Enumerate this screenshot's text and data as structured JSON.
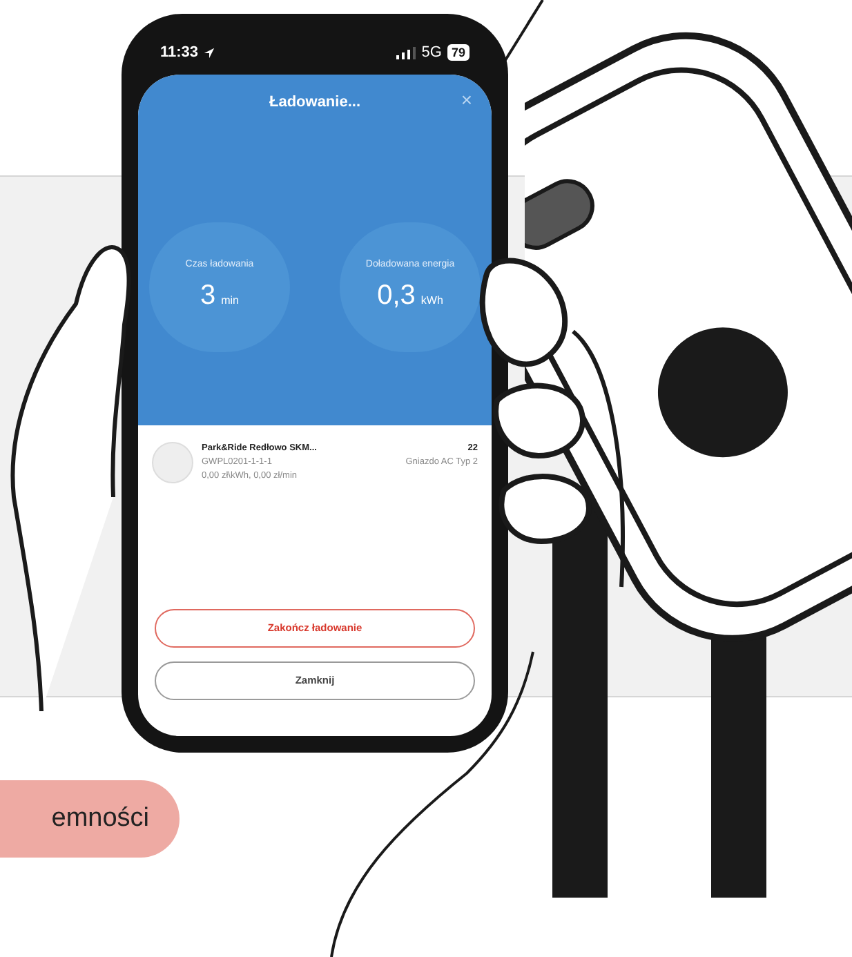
{
  "status_bar": {
    "time": "11:33",
    "network": "5G",
    "battery": "79"
  },
  "header": {
    "title": "Ładowanie...",
    "close": "×"
  },
  "stats": [
    {
      "label": "Czas ładowania",
      "value": "3",
      "unit": "min"
    },
    {
      "label": "Doładowana energia",
      "value": "0,3",
      "unit": "kWh"
    }
  ],
  "station": {
    "name": "Park&Ride Redłowo SKM...",
    "code": "GWPL0201-1-1-1",
    "price": "0,00 zł\\kWh, 0,00 zł/min",
    "power": "22",
    "socket": "Gniazdo AC Typ 2"
  },
  "buttons": [
    {
      "label": "Zakończ ładowanie",
      "kind": "danger"
    },
    {
      "label": "Zamknij",
      "kind": "plain"
    }
  ],
  "page_button": {
    "label": "emności"
  }
}
